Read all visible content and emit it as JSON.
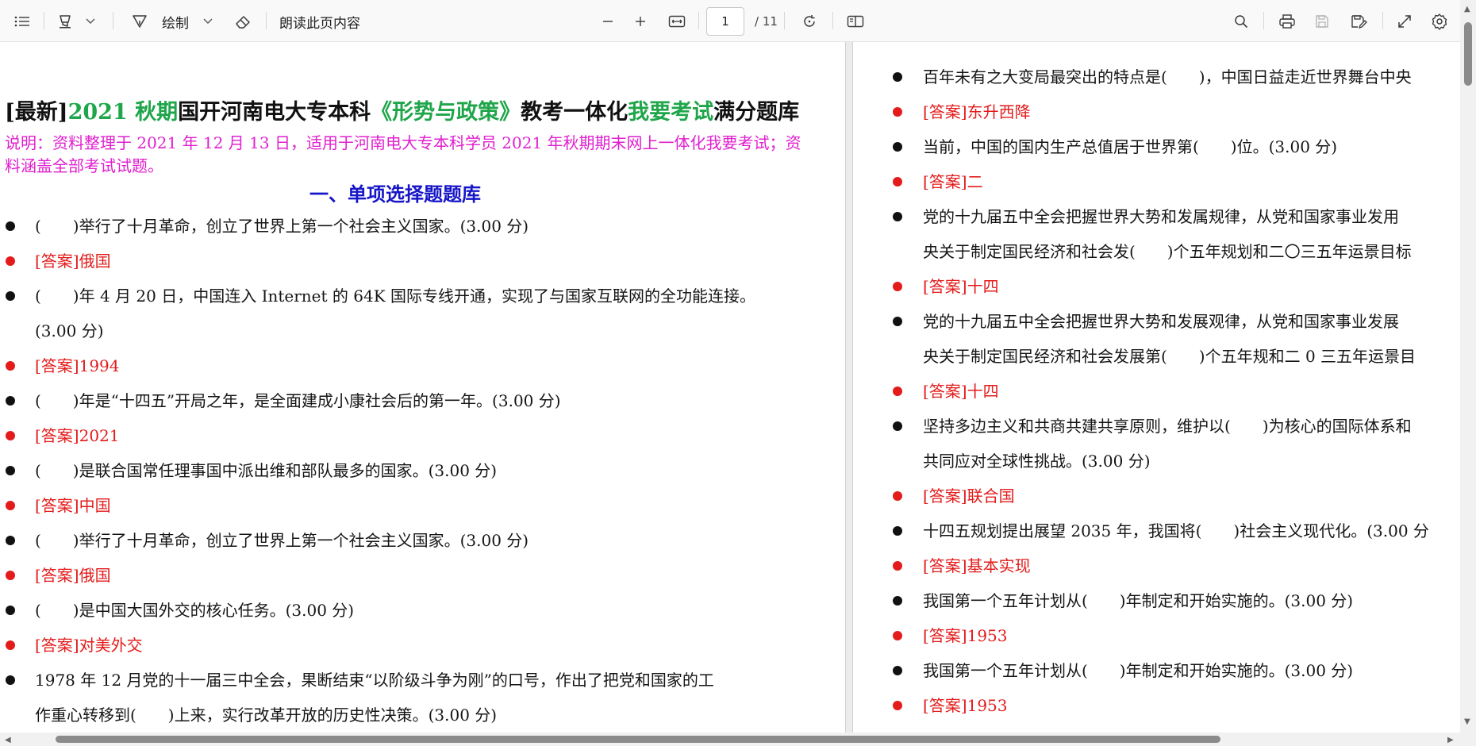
{
  "toolbar": {
    "draw_label": "绘制",
    "read_aloud_label": "朗读此页内容",
    "page_current": "1",
    "page_total": "/ 11",
    "icons": [
      "contents-icon",
      "highlight-icon",
      "chevron-down-icon",
      "draw-icon",
      "chevron-down-icon",
      "eraser-icon",
      "zoom-out-icon",
      "zoom-in-icon",
      "fit-width-icon",
      "rotate-icon",
      "page-view-icon",
      "search-icon",
      "print-icon",
      "save-icon",
      "save-as-icon",
      "fullscreen-icon",
      "settings-icon"
    ]
  },
  "document": {
    "title": {
      "p1": "[最新]",
      "p2": "2021 秋期",
      "p3": "国开河南电大专本科",
      "p4": "《形势与政策》",
      "p5": "教考一体化",
      "p6": "我要考试",
      "p7": "满分题库"
    },
    "description": "说明：资料整理于 2021 年 12 月 13 日，适用于河南电大专本科学员 2021 年秋期期末网上一体化我要考试；资料涵盖全部考试试题。",
    "section_title": "一、单项选择题题库",
    "left_items": [
      {
        "type": "q",
        "text": "(　　)举行了十月革命，创立了世界上第一个社会主义国家。(3.00 分)"
      },
      {
        "type": "a",
        "text": "[答案]俄国"
      },
      {
        "type": "q",
        "text": "(　　)年 4 月 20 日，中国连入 Internet 的 64K 国际专线开通，实现了与国家互联网的全功能连接。",
        "cont": "(3.00 分)"
      },
      {
        "type": "a",
        "text": "[答案]1994"
      },
      {
        "type": "q",
        "text": "(　　)年是“十四五”开局之年，是全面建成小康社会后的第一年。(3.00 分)"
      },
      {
        "type": "a",
        "text": "[答案]2021"
      },
      {
        "type": "q",
        "text": "(　　)是联合国常任理事国中派出维和部队最多的国家。(3.00 分)"
      },
      {
        "type": "a",
        "text": "[答案]中国"
      },
      {
        "type": "q",
        "text": "(　　)举行了十月革命，创立了世界上第一个社会主义国家。(3.00 分)"
      },
      {
        "type": "a",
        "text": "[答案]俄国"
      },
      {
        "type": "q",
        "text": "(　　)是中国大国外交的核心任务。(3.00 分)"
      },
      {
        "type": "a",
        "text": "[答案]对美外交"
      },
      {
        "type": "q",
        "text": "1978 年 12 月党的十一届三中全会，果断结束“以阶级斗争为刚”的口号，作出了把党和国家的工",
        "cont": "作重心转移到(　　)上来，实行改革开放的历史性决策。(3.00 分)"
      }
    ],
    "right_items": [
      {
        "type": "q",
        "text": "百年未有之大变局最突出的特点是(　　)，中国日益走近世界舞台中央"
      },
      {
        "type": "a",
        "text": "[答案]东升西降"
      },
      {
        "type": "q",
        "text": "当前，中国的国内生产总值居于世界第(　　)位。(3.00 分)"
      },
      {
        "type": "a",
        "text": "[答案]二"
      },
      {
        "type": "q",
        "text": "党的十九届五中全会把握世界大势和发属规律，从党和国家事业发用",
        "cont": "央关于制定国民经济和社会发(　　)个五年规划和二〇三五年运景目标"
      },
      {
        "type": "a",
        "text": "[答案]十四"
      },
      {
        "type": "q",
        "text": "党的十九届五中全会把握世界大势和发展观律，从党和国家事业发展",
        "cont": "央关于制定国民经济和社会发展第(　　)个五年规和二 0 三五年运景目"
      },
      {
        "type": "a",
        "text": "[答案]十四"
      },
      {
        "type": "q",
        "text": "坚持多边主义和共商共建共享原则，维护以(　　)为核心的国际体系和",
        "cont": "共同应对全球性挑战。(3.00 分)"
      },
      {
        "type": "a",
        "text": "[答案]联合国"
      },
      {
        "type": "q",
        "text": "十四五规划提出展望 2035 年，我国将(　　)社会主义现代化。(3.00 分"
      },
      {
        "type": "a",
        "text": "[答案]基本实现"
      },
      {
        "type": "q",
        "text": "我国第一个五年计划从(　　)年制定和开始实施的。(3.00 分)"
      },
      {
        "type": "a",
        "text": "[答案]1953"
      },
      {
        "type": "q",
        "text": "我国第一个五年计划从(　　)年制定和开始实施的。(3.00 分)"
      },
      {
        "type": "a",
        "text": "[答案]1953"
      }
    ]
  }
}
